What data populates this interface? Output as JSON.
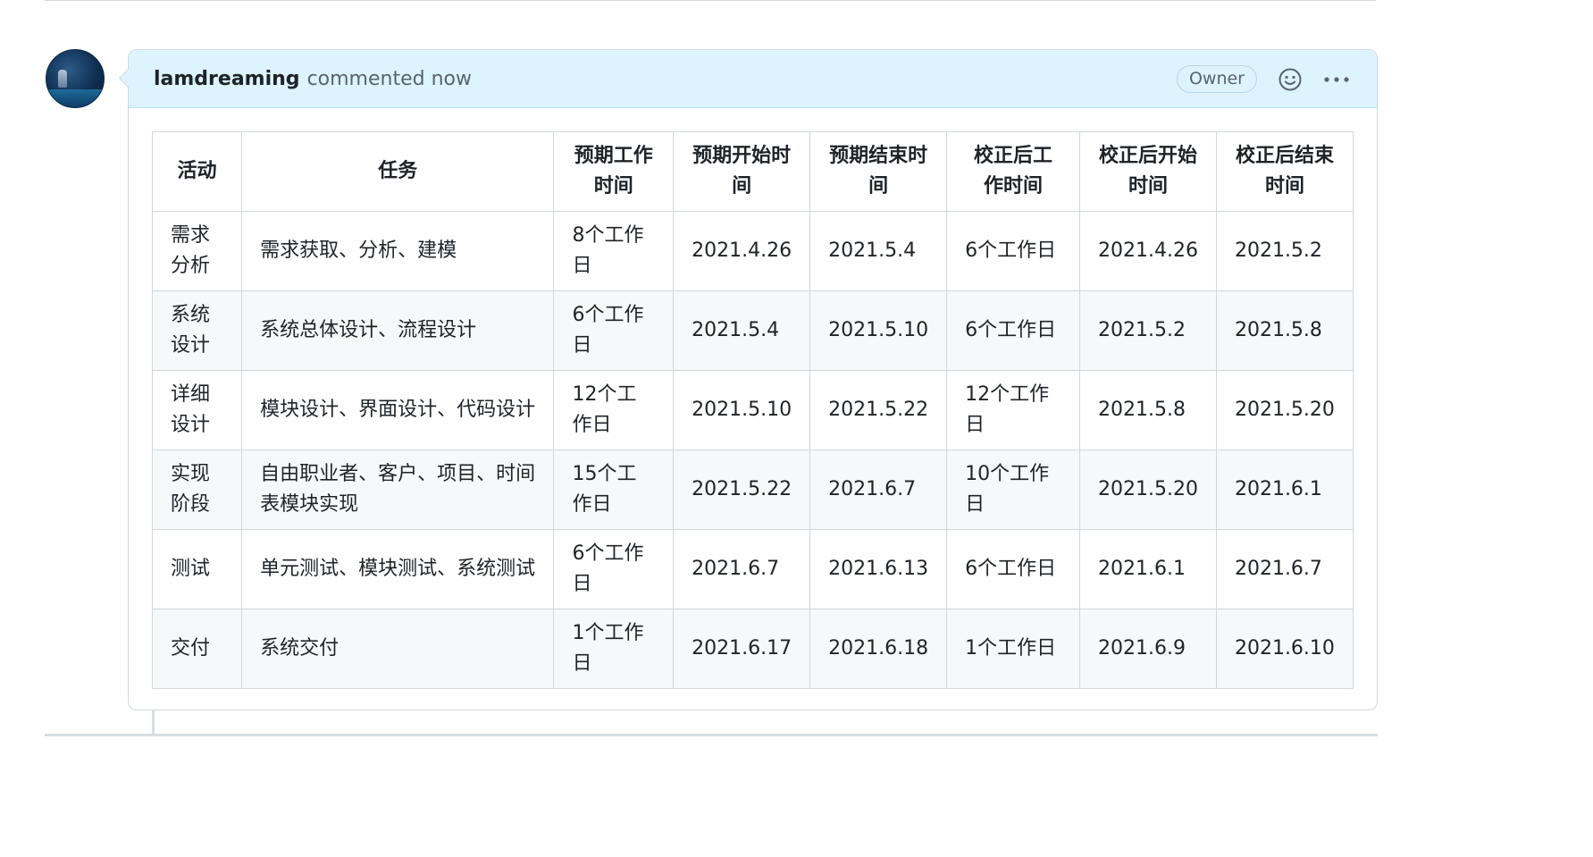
{
  "comment": {
    "author": "lamdreaming",
    "action": "commented now",
    "badge": "Owner",
    "reaction_icon": "smiley-icon",
    "menu_icon": "kebab-horizontal-icon"
  },
  "table": {
    "headers": [
      "活动",
      "任务",
      "预期工作时间",
      "预期开始时间",
      "预期结束时间",
      "校正后工作时间",
      "校正后开始时间",
      "校正后结束时间"
    ],
    "rows": [
      [
        "需求分析",
        "需求获取、分析、建模",
        "8个工作日",
        "2021.4.26",
        "2021.5.4",
        "6个工作日",
        "2021.4.26",
        "2021.5.2"
      ],
      [
        "系统设计",
        "系统总体设计、流程设计",
        "6个工作日",
        "2021.5.4",
        "2021.5.10",
        "6个工作日",
        "2021.5.2",
        "2021.5.8"
      ],
      [
        "详细设计",
        "模块设计、界面设计、代码设计",
        "12个工作日",
        "2021.5.10",
        "2021.5.22",
        "12个工作日",
        "2021.5.8",
        "2021.5.20"
      ],
      [
        "实现阶段",
        "自由职业者、客户、项目、时间表模块实现",
        "15个工作日",
        "2021.5.22",
        "2021.6.7",
        "10个工作日",
        "2021.5.20",
        "2021.6.1"
      ],
      [
        "测试",
        "单元测试、模块测试、系统测试",
        "6个工作日",
        "2021.6.7",
        "2021.6.13",
        "6个工作日",
        "2021.6.1",
        "2021.6.7"
      ],
      [
        "交付",
        "系统交付",
        "1个工作日",
        "2021.6.17",
        "2021.6.18",
        "1个工作日",
        "2021.6.9",
        "2021.6.10"
      ]
    ]
  }
}
